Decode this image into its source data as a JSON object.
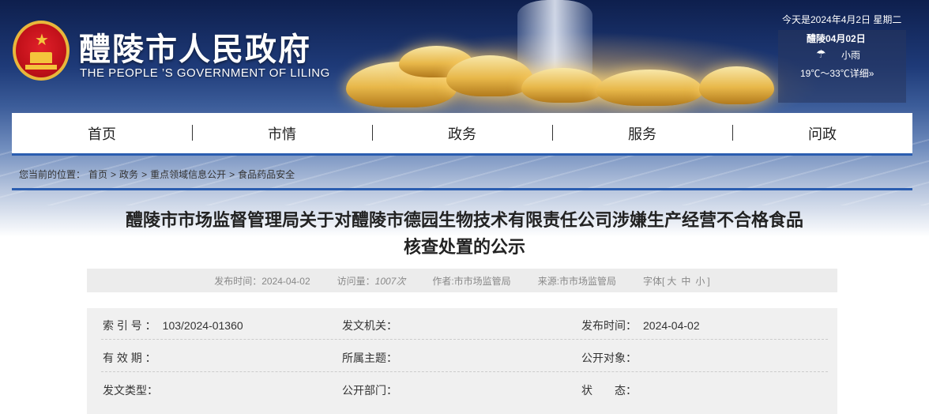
{
  "header": {
    "title": "醴陵市人民政府",
    "subtitle": "THE PEOPLE ’S GOVERNMENT OF LILING",
    "today": "今天是2024年4月2日 星期二",
    "weather": {
      "date": "醴陵04月02日",
      "icon": "light-rain-icon",
      "condition": "小雨",
      "temp": "19℃～33℃详细»"
    }
  },
  "nav": {
    "items": [
      "首页",
      "市情",
      "政务",
      "服务",
      "问政"
    ]
  },
  "breadcrumb": {
    "prefix": "您当前的位置：",
    "items": [
      "首页",
      "政务",
      "重点领域信息公开",
      "食品药品安全"
    ]
  },
  "article": {
    "title_line1": "醴陵市市场监督管理局关于对醴陵市德园生物技术有限责任公司涉嫌生产经营不合格食品",
    "title_line2": "核查处置的公示",
    "meta": {
      "publish_label": "发布时间：",
      "publish_date": "2024-04-02",
      "views_label": "访问量：",
      "views_value": "1007次",
      "author": "作者:市市场监管局",
      "source": "来源:市市场监管局",
      "font_label": "字体[",
      "font_large": "大",
      "font_mid": "中",
      "font_small": "小",
      "font_close": "]"
    },
    "info": {
      "index_label": "索 引 号 ：",
      "index_value": "103/2024-01360",
      "issuer_label": "发文机关：",
      "issuer_value": "",
      "pubtime_label": "发布时间：",
      "pubtime_value": "2024-04-02",
      "validity_label": "有 效 期 ：",
      "validity_value": "",
      "topic_label": "所属主题：",
      "topic_value": "",
      "audience_label": "公开对象：",
      "audience_value": "",
      "doctype_label": "发文类型：",
      "doctype_value": "",
      "dept_label": "公开部门：",
      "dept_value": "",
      "status_label": "状　　态：",
      "status_value": ""
    }
  },
  "colors": {
    "accent": "#2a5db0",
    "meta_bg": "#ececec",
    "info_bg": "#f0f0f0"
  }
}
